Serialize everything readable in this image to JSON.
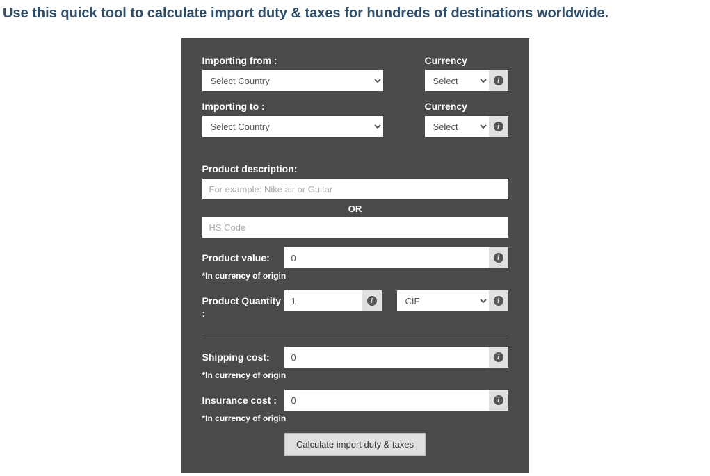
{
  "headline": "Use this  quick   tool   to calculate import duty & taxes for hundreds of destinations worldwide.",
  "form": {
    "importingFromLabel": "Importing from :",
    "importingFromValue": "Select Country",
    "currencyFromLabel": "Currency",
    "currencyFromValue": "Select",
    "importingToLabel": "Importing to :",
    "importingToValue": "Select Country",
    "currencyToLabel": "Currency",
    "currencyToValue": "Select",
    "productDescLabel": "Product description:",
    "productDescPlaceholder": "For example: Nike air or Guitar",
    "orLabel": "OR",
    "hsCodePlaceholder": "HS Code",
    "productValueLabel": "Product value:",
    "productValueValue": "0",
    "currencyOriginHint": "*In currency of origin",
    "productQtyLabel": "Product Quantity :",
    "productQtyValue": "1",
    "shipTermValue": "CIF",
    "shippingCostLabel": "Shipping cost:",
    "shippingCostValue": "0",
    "insuranceCostLabel": "Insurance cost :",
    "insuranceCostValue": "0",
    "submitLabel": "Calculate import duty & taxes"
  }
}
